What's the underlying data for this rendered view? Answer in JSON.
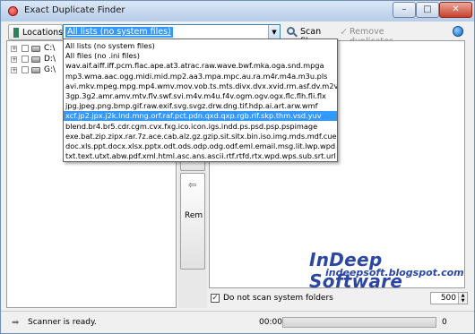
{
  "window": {
    "title": "Exact Duplicate Finder"
  },
  "toolbar": {
    "locations_label": "Locations",
    "combo_value": "All lists (no system files)",
    "scan_label": "Scan files",
    "remove_label": "Remove duplicates"
  },
  "dropdown": {
    "items": [
      "All lists (no system files)",
      "All files (no .ini files)",
      "wav.aif.aiff.iff.pcm.flac.ape.at3.atrac.raw.wave.bwf.mka.oga.snd.mpga",
      "mp3.wma.aac.ogg.midi.mid.mp2.aa3.mpa.mpc.au.ra.m4r.m4a.m3u.pls",
      "avi.mkv.mpeg.mpg.mp4.wmv.mov.vob.ts.mts.divx.dvx.xvid.rm.asf.dv.m2v",
      "3gp.3g2.amr.amv.mtv.flv.swf.svi.m4v.m4u.f4v.ogm.ogv.ogx.flc.flh.fli.flx",
      "jpg.jpeg.png.bmp.gif.raw.exif.svg.svgz.drw.dng.tif.hdp.ai.art.arw.wmf",
      "xcf.jp2.jpx.j2k.lnd.mng.orf.raf.pct.pdn.qxd.qxp.rgb.rif.skp.thm.vsd.yuv",
      "blend.br4.br5.cdr.cgm.cvx.fxg.ico.icon.igs.indd.ps.psd.psp.pspimage",
      "exe.bat.zip.zipx.rar.7z.ace.cab.alz.gz.gzip.sit.sitx.bin.iso.img.mds.mdf.cue",
      "doc.xls.ppt.docx.xlsx.pptx.odt.ods.odp.odg.odf.eml.email.msg.lit.lwp.wpd",
      "txt.text.utxt.abw.pdf.xml.html.asc.ans.ascii.rtf.rtfd.rtx.wpd.wps.sub.srt.url"
    ],
    "selected_index": 7
  },
  "tree": {
    "drives": [
      "C:\\",
      "D:\\",
      "G:\\"
    ]
  },
  "middle": {
    "remove_label": "Rem"
  },
  "options": {
    "no_system_label": "Do not scan system folders",
    "no_system_checked": "✓",
    "max_value": "500"
  },
  "branding": {
    "name": "InDeep Software",
    "url": "indeepsoft.blogspot.com"
  },
  "status": {
    "text": "Scanner is ready.",
    "time": "00:00",
    "count": "0",
    "progress": 0
  },
  "colors": {
    "selection": "#3399ff",
    "brand": "#2b47a3"
  }
}
